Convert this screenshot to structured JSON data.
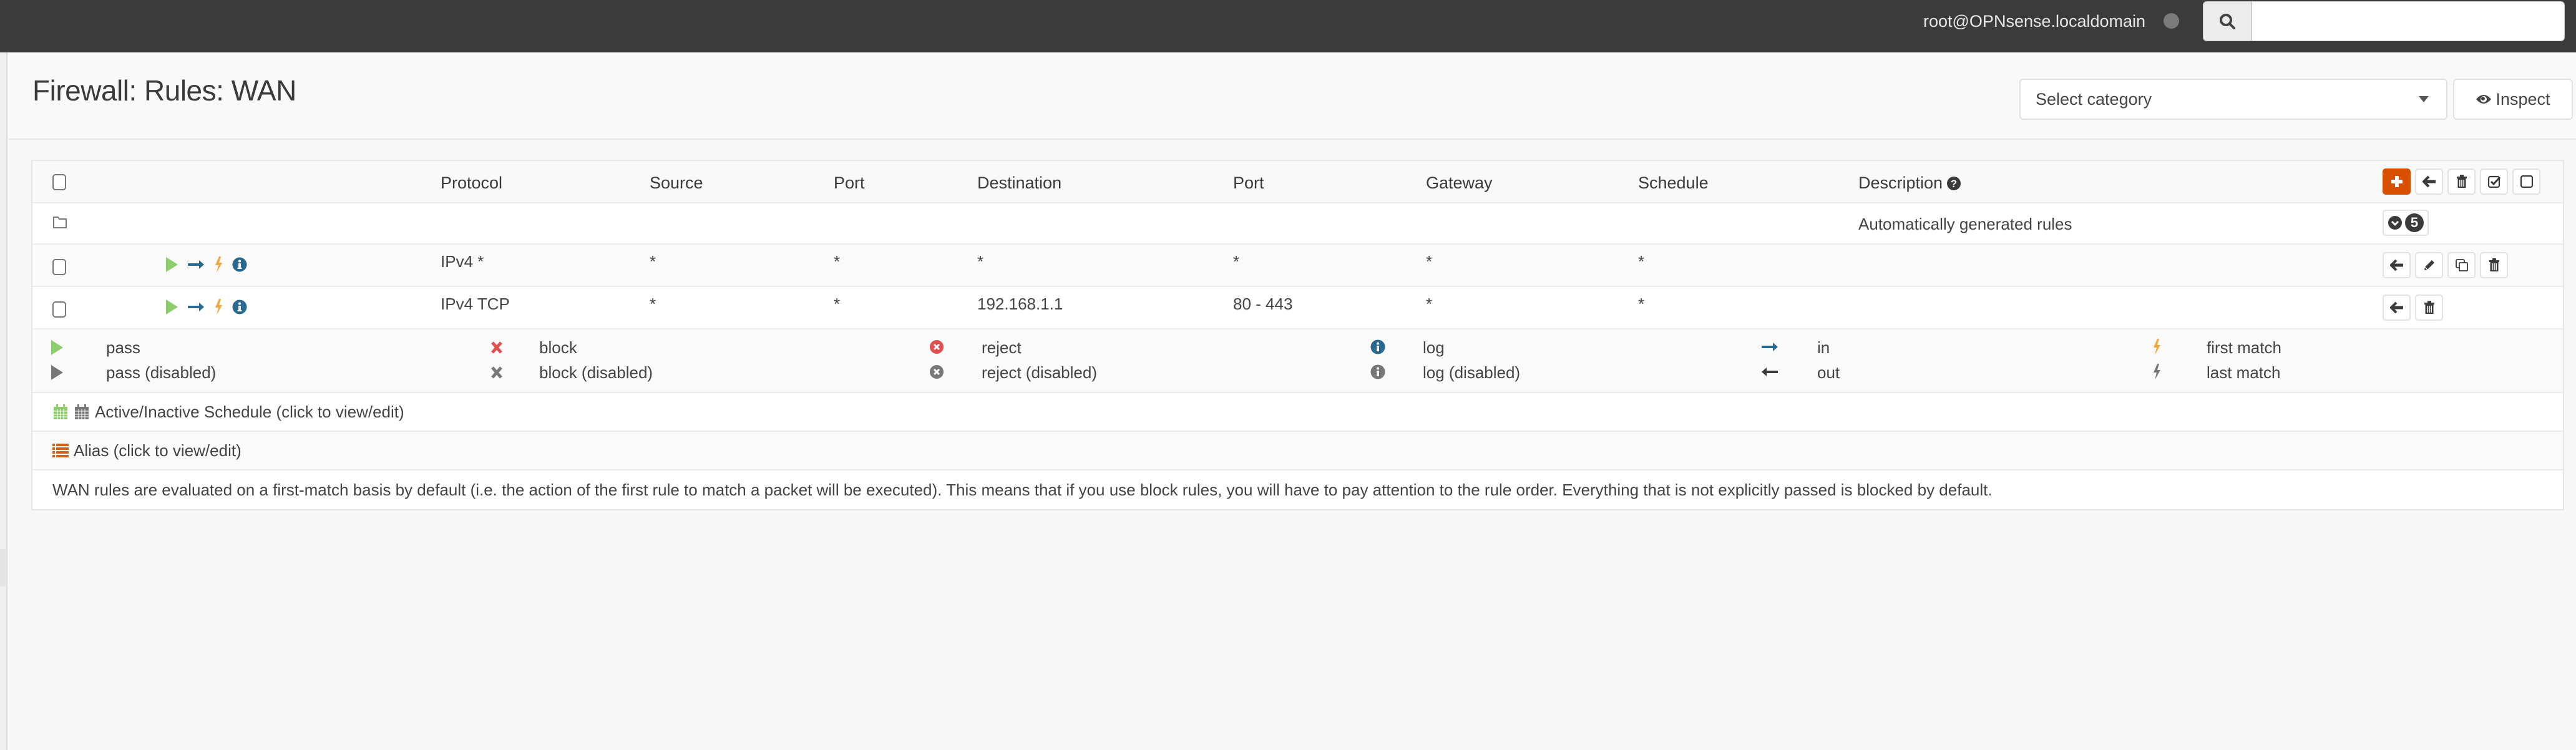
{
  "navbar": {
    "user": "root@OPNsense.localdomain",
    "search": {
      "value": "",
      "placeholder": ""
    }
  },
  "header": {
    "title": "Firewall: Rules: WAN",
    "category_select": {
      "selected": "Select category"
    },
    "inspect_label": "Inspect"
  },
  "table": {
    "columns": [
      "",
      "",
      "Protocol",
      "Source",
      "Port",
      "Destination",
      "Port",
      "Gateway",
      "Schedule",
      "Description"
    ],
    "category_row": {
      "description": "Automatically generated rules",
      "count": "5"
    },
    "rules": [
      {
        "protocol": "IPv4 *",
        "source": "*",
        "source_port": "*",
        "destination": "*",
        "destination_port": "*",
        "gateway": "*",
        "schedule": "*",
        "description": "",
        "action": "pass",
        "direction": "in",
        "quick": "first match",
        "log": true
      },
      {
        "protocol": "IPv4 TCP",
        "source": "*",
        "source_port": "*",
        "destination": "192.168.1.1",
        "destination_port": "80 - 443",
        "gateway": "*",
        "schedule": "*",
        "description": "",
        "action": "pass",
        "direction": "in",
        "quick": "first match",
        "log": true
      }
    ]
  },
  "legend": {
    "pass": "pass",
    "pass_disabled": "pass (disabled)",
    "block": "block",
    "block_disabled": "block (disabled)",
    "reject": "reject",
    "reject_disabled": "reject (disabled)",
    "log": "log",
    "log_disabled": "log (disabled)",
    "in": "in",
    "out": "out",
    "first_match": "first match",
    "last_match": "last match"
  },
  "schedule_info": "Active/Inactive Schedule (click to view/edit)",
  "alias_info": "Alias (click to view/edit)",
  "note": "WAN rules are evaluated on a first-match basis by default (i.e. the action of the first rule to match a packet will be executed). This means that if you use block rules, you will have to pay attention to the rule order. Everything that is not explicitly passed is blocked by default.",
  "colors": {
    "navbar": "#3b3b3b",
    "accent": "#d94f00",
    "pass": "#8fcc6e",
    "block": "#e05050",
    "log": "#2a6a8f",
    "quick": "#f0a840",
    "disabled": "#777777",
    "schedule_active": "#8fcc6e",
    "alias": "#d0621c"
  }
}
